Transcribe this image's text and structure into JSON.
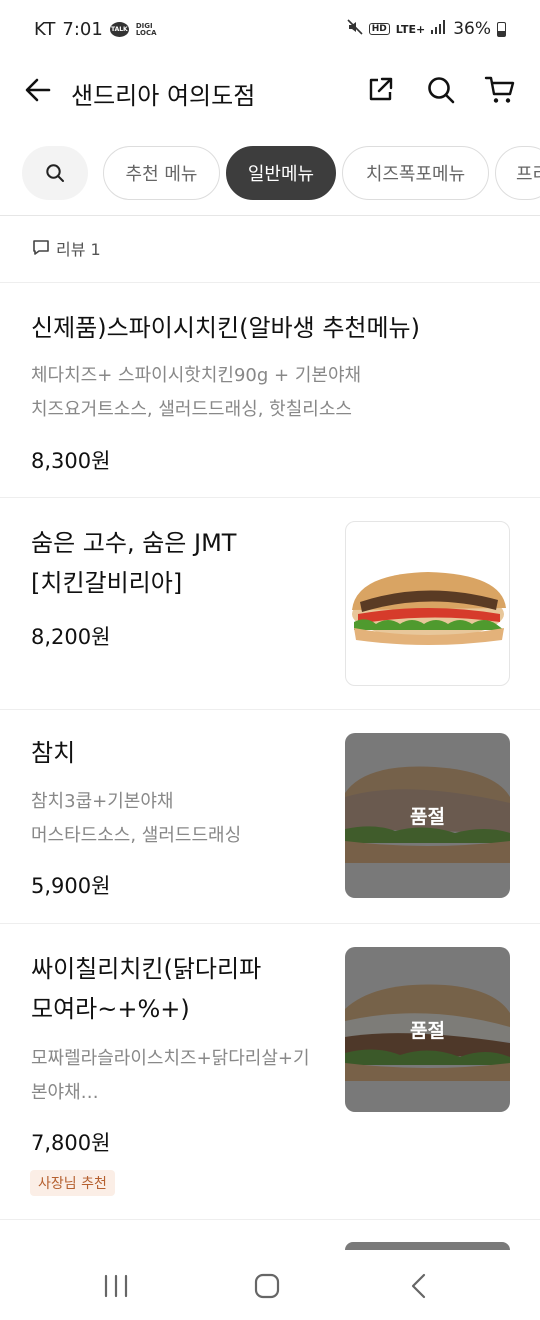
{
  "status_bar": {
    "carrier": "KT",
    "time": "7:01",
    "talk_label": "TALK",
    "digi_label": "DIGI LOCA",
    "hd_label": "HD",
    "network": "LTE+",
    "battery": "36%"
  },
  "header": {
    "title": "샌드리아 여의도점"
  },
  "tabs": [
    {
      "label": "추천 메뉴",
      "active": false
    },
    {
      "label": "일반메뉴",
      "active": true
    },
    {
      "label": "치즈폭포메뉴",
      "active": false
    },
    {
      "label": "프리",
      "active": false
    }
  ],
  "review": {
    "label": "리뷰 1"
  },
  "menu_items": [
    {
      "name": "신제품)스파이시치킨(알바생 추천메뉴)",
      "desc_lines": [
        "체다치즈+ 스파이시핫치킨90g + 기본야채",
        "치즈요거트소스, 샐러드드래싱, 핫칠리소스"
      ],
      "price": "8,300원"
    },
    {
      "name_lines": [
        "숨은 고수, 숨은 JMT",
        "[치킨갈비리아]"
      ],
      "price": "8,200원",
      "image": "sandwich-image"
    },
    {
      "name": "참치",
      "desc_lines": [
        "참치3쿱+기본야채",
        "머스타드소스, 샐러드드래싱"
      ],
      "price": "5,900원",
      "image": "sandwich-image",
      "sold_out_label": "품절"
    },
    {
      "name_lines": [
        "싸이칠리치킨(닭다리파",
        "모여라~+%+)"
      ],
      "desc_lines": [
        "모짜렐라슬라이스치즈+닭다리살+기",
        "본야채…"
      ],
      "price": "7,800원",
      "image": "sandwich-image",
      "sold_out_label": "품절",
      "badge": "사장님 추천"
    }
  ],
  "nav": {
    "recents_icon": "recents-icon",
    "home_icon": "home-icon",
    "back_icon": "back-icon"
  }
}
